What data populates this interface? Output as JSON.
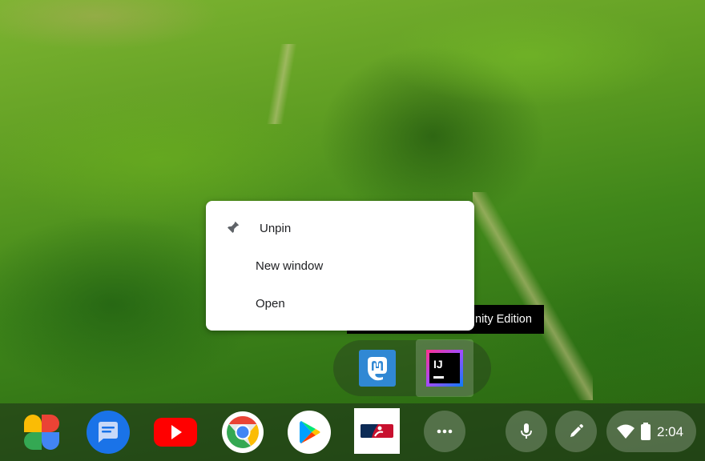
{
  "context_menu": {
    "items": [
      {
        "label": "Unpin",
        "icon": "pin-icon"
      },
      {
        "label": "New window"
      },
      {
        "label": "Open"
      }
    ]
  },
  "tooltip": {
    "text": "nity Edition"
  },
  "popup_apps": [
    {
      "name": "mastodon",
      "icon": "mastodon-icon"
    },
    {
      "name": "intellij",
      "icon": "intellij-icon",
      "logo_text": "IJ",
      "selected": true
    }
  ],
  "shelf": {
    "apps": [
      {
        "icon": "google-photos-icon"
      },
      {
        "icon": "messages-icon"
      },
      {
        "icon": "youtube-icon"
      },
      {
        "icon": "chrome-icon"
      },
      {
        "icon": "play-store-icon"
      },
      {
        "icon": "mlb-icon"
      },
      {
        "icon": "more-apps-icon"
      }
    ],
    "tray": {
      "mic_icon": "microphone-icon",
      "stylus_icon": "stylus-icon",
      "wifi_icon": "wifi-icon",
      "battery_icon": "battery-icon",
      "time": "2:04"
    }
  },
  "colors": {
    "menu_bg": "#ffffff",
    "menu_text": "#202124",
    "tooltip_bg": "#000000",
    "youtube_red": "#ff0000",
    "mastodon_blue": "#3088d4"
  }
}
